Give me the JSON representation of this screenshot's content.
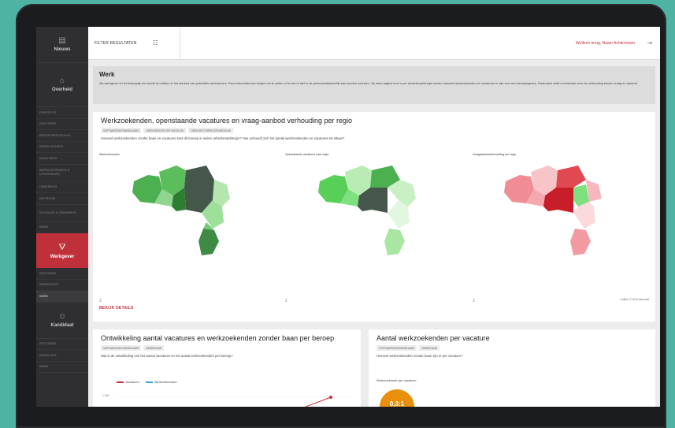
{
  "sidebar": {
    "nieuws": "Nieuws",
    "overheid": "Overheid",
    "overheid_items": [
      "OVERZICHT",
      "ZOEKTERM",
      "BEROEPSBEVOLKING",
      "WERKLOOSHEID",
      "VACATURES",
      "WERKZOEKENDEN & UITKERINGEN",
      "ONDERWIJS",
      "INSTROOM",
      "SCHOLING & ONDERWIJS",
      "WERK"
    ],
    "werkgever": "Werkgever",
    "werkgever_items": [
      "ZOEKTERM",
      "WERKGEVER",
      "WERK"
    ],
    "kandidaat": "Kandidaat",
    "kandidaat_items": [
      "ZOEKTERM",
      "WERKLOOS",
      "WERK"
    ]
  },
  "topbar": {
    "filter_label": "FILTER RESULTATEN",
    "welcome": "Welkom terug, Naam Achternaam"
  },
  "intro": {
    "title": "Werk",
    "text": "Als werkgever is het belangrijk om inzicht te hebben in het aanbod van potentiële werknemers. Deze informatie kan helpen om te weten of er wel of niet in de personeelsbehoefte kan worden voorzien. Op deze pagina kunt u per arbeidsmarktregio vinden hoeveel werkzoekenden en vacatures er zijn voor een beroepsgroep. Daarnaast vindt u informatie over de verhouding tussen vraag en aanbod."
  },
  "card1": {
    "title": "Werkzoekenden, openstaande vacatures en vraag-aanbod verhouding per regio",
    "tags": [
      "SOFTWAREONTWIKKELAARS",
      "GEEN REGIOFILTER MOGELIJK",
      "GEEN SECTORFILTER MOGELIJK"
    ],
    "subtitle": "Hoeveel werkzoekenden zonder baan en vacatures kent dit beroep in iedere arbeidsmarktregio? Hoe verhoudt zich het aantal werkzoekenden en vacatures tot elkaar?",
    "map1_label": "Werkzoekenden",
    "map2_label": "Openstaande vacatures naar regio",
    "map3_label": "Vraag/aanbodverhouding per regio",
    "details": "BEKIJK DETAILS",
    "leaflet": "Leaflet | © 2015 Intermedi"
  },
  "card2": {
    "title": "Ontwikkeling aantal vacatures en werkzoekenden zonder baan per beroep",
    "tags": [
      "SOFTWAREONTWIKKELAARS",
      "NEDERLAND"
    ],
    "subtitle": "Wat is de ontwikkeling van het aantal vacatures en het aantal werkzoekenden per beroep?",
    "legend_vacatures": "Vacatures",
    "legend_werkzoekenden": "Werkzoekenden",
    "tick": "1.000"
  },
  "card3": {
    "title": "Aantal werkzoekenden per vacature",
    "tags": [
      "SOFTWAREONTWIKKELAARS",
      "NEDERLAND"
    ],
    "subtitle": "Hoeveel werkzoekenden zonder baan zijn er per vacature?",
    "gauge_label": "Werkzoekende per vacature:",
    "gauge_value": "0,3:1"
  },
  "colors": {
    "accent": "#c0303a",
    "gauge": "#e8900c",
    "vacatures_line": "#c0303a",
    "werkzoekenden_line": "#3aa0d8"
  }
}
